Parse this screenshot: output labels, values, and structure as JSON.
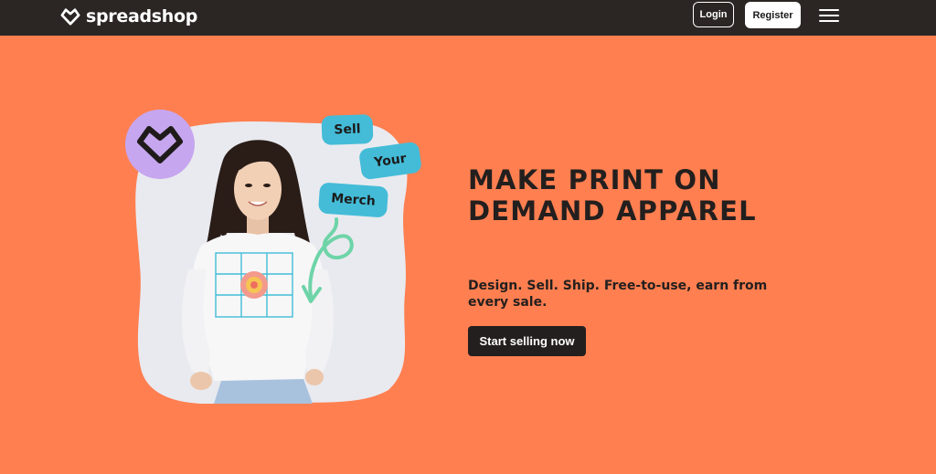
{
  "header": {
    "logo_text": "spreadshop",
    "login_label": "Login",
    "register_label": "Register"
  },
  "hero": {
    "headline": "MAKE PRINT ON DEMAND APPAREL",
    "subtext": "Design. Sell. Ship. Free-to-use, earn from every sale.",
    "cta_label": "Start selling now",
    "pills": {
      "sell": "Sell",
      "your": "Your",
      "merch": "Merch"
    }
  },
  "colors": {
    "header_bg": "#2b2624",
    "hero_bg": "#ff7f50",
    "pill": "#44bcd8",
    "badge": "#c7a6f0",
    "cta_bg": "#231f1e"
  },
  "icons": [
    "spreadshop-heart-logo-icon",
    "hamburger-menu-icon",
    "curly-arrow-icon"
  ]
}
